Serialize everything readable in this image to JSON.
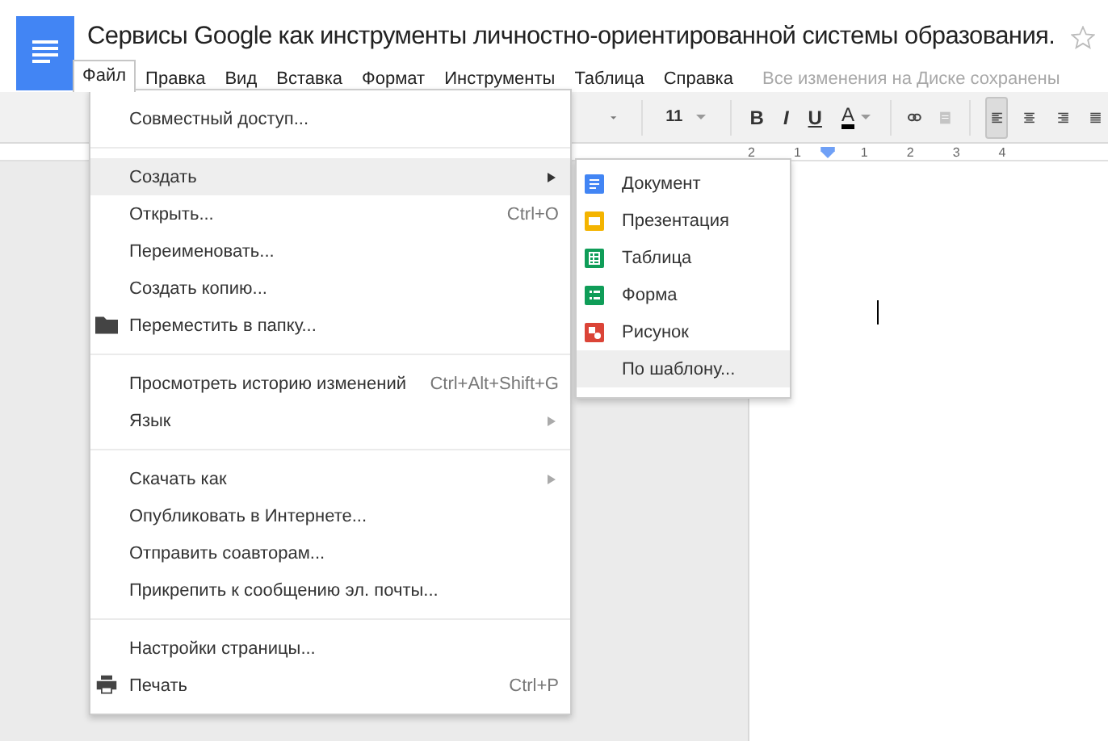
{
  "title": "Сервисы Google как инструменты личностно-ориентированной системы образования.",
  "menu_bar": [
    {
      "label": "Файл",
      "selected": true
    },
    {
      "label": "Правка",
      "selected": false
    },
    {
      "label": "Вид",
      "selected": false
    },
    {
      "label": "Вставка",
      "selected": false
    },
    {
      "label": "Формат",
      "selected": false
    },
    {
      "label": "Инструменты",
      "selected": false
    },
    {
      "label": "Таблица",
      "selected": false
    },
    {
      "label": "Справка",
      "selected": false
    }
  ],
  "save_status": "Все изменения на Диске сохранены",
  "toolbar": [
    {
      "kind": "dropdown"
    },
    {
      "kind": "size",
      "label": "11"
    },
    {
      "kind": "bold",
      "label": "B"
    },
    {
      "kind": "italic",
      "label": "I"
    },
    {
      "kind": "underline",
      "label": "U"
    },
    {
      "kind": "color",
      "label": "A"
    },
    {
      "kind": "link",
      "disabled": false
    },
    {
      "kind": "comment",
      "disabled": true
    },
    {
      "kind": "align-left",
      "selected": true
    },
    {
      "kind": "align-center",
      "selected": false
    },
    {
      "kind": "align-right",
      "selected": false
    },
    {
      "kind": "justify",
      "selected": false
    }
  ],
  "ruler": [
    "2",
    "1",
    "1",
    "2",
    "3",
    "4"
  ],
  "file_menu": [
    [
      {
        "label": "Совместный доступ...",
        "selected": false
      }
    ],
    [
      {
        "label": "Создать",
        "submenu": true,
        "selected": true
      },
      {
        "label": "Открыть...",
        "shortcut": "Ctrl+O",
        "selected": false
      },
      {
        "label": "Переименовать...",
        "selected": false
      },
      {
        "label": "Создать копию...",
        "selected": false
      },
      {
        "label": "Переместить в папку...",
        "kind": "folder",
        "selected": false
      }
    ],
    [
      {
        "label": "Просмотреть историю изменений",
        "shortcut": "Ctrl+Alt+Shift+G",
        "selected": false
      },
      {
        "label": "Язык",
        "submenu": true,
        "selected": false
      }
    ],
    [
      {
        "label": "Скачать как",
        "submenu": true,
        "selected": false
      },
      {
        "label": "Опубликовать в Интернете...",
        "selected": false
      },
      {
        "label": "Отправить соавторам...",
        "selected": false
      },
      {
        "label": "Прикрепить к сообщению эл. почты...",
        "selected": false
      }
    ],
    [
      {
        "label": "Настройки страницы...",
        "selected": false
      },
      {
        "label": "Печать",
        "kind": "printer",
        "shortcut": "Ctrl+P",
        "selected": false
      }
    ]
  ],
  "create_submenu": [
    {
      "label": "Документ",
      "kind": "document",
      "color": "#4285f4",
      "selected": false
    },
    {
      "label": "Презентация",
      "kind": "presentation",
      "color": "#f4b400",
      "selected": false
    },
    {
      "label": "Таблица",
      "kind": "spreadsheet",
      "color": "#0f9d58",
      "selected": false
    },
    {
      "label": "Форма",
      "kind": "form",
      "color": "#0f9d58",
      "selected": false
    },
    {
      "label": "Рисунок",
      "kind": "drawing",
      "color": "#db4437",
      "selected": false
    },
    {
      "label": "По шаблону...",
      "selected": true
    }
  ]
}
